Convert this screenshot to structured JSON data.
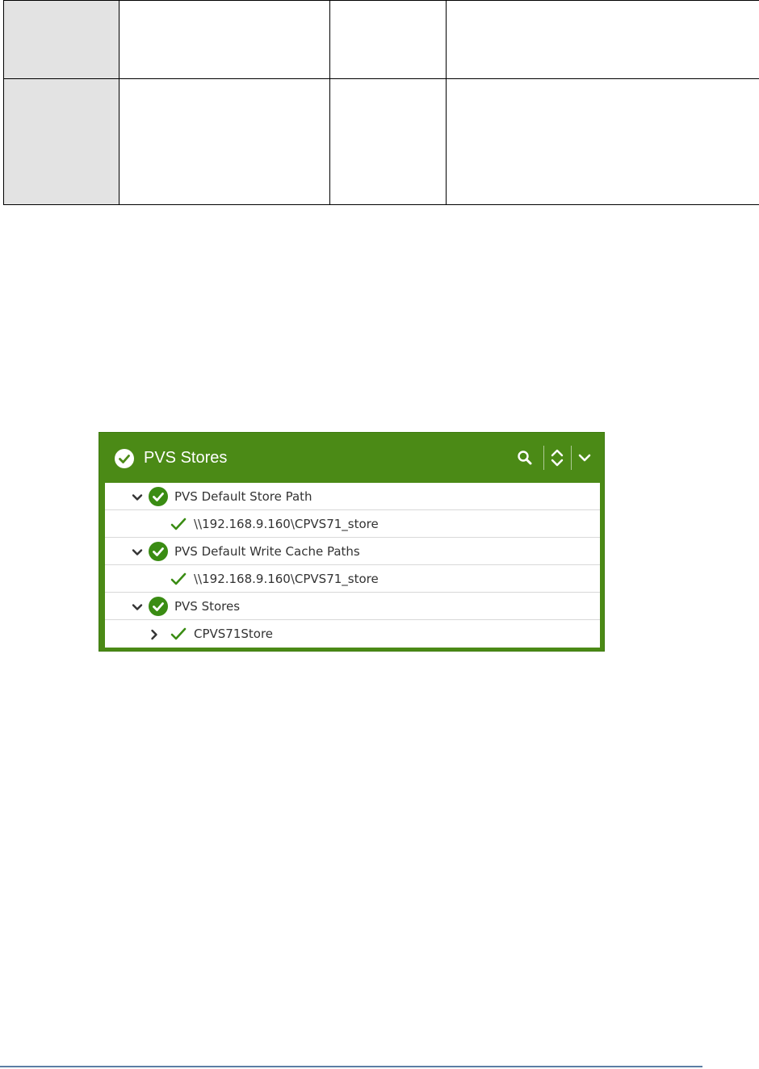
{
  "colors": {
    "panel_green": "#4b8a16",
    "ok_green": "#3a8c13",
    "table_header_gray": "#e3e3e3",
    "footer_rule": "#5b7ea4"
  },
  "panel": {
    "title": "PVS Stores",
    "header_icons": [
      "check-circle-icon",
      "search-icon",
      "expand-collapse-icon",
      "chevron-down-icon"
    ],
    "rows": [
      {
        "label": "PVS Default Store Path",
        "level": 0,
        "toggle": "expanded",
        "status": "ok-circle"
      },
      {
        "label": "\\\\192.168.9.160\\CPVS71_store",
        "level": 1,
        "toggle": "none",
        "status": "check"
      },
      {
        "label": "PVS Default Write Cache Paths",
        "level": 0,
        "toggle": "expanded",
        "status": "ok-circle"
      },
      {
        "label": "\\\\192.168.9.160\\CPVS71_store",
        "level": 1,
        "toggle": "none",
        "status": "check"
      },
      {
        "label": "PVS Stores",
        "level": 0,
        "toggle": "expanded",
        "status": "ok-circle"
      },
      {
        "label": "CPVS71Store",
        "level": 1,
        "toggle": "collapsed",
        "status": "check"
      }
    ]
  }
}
